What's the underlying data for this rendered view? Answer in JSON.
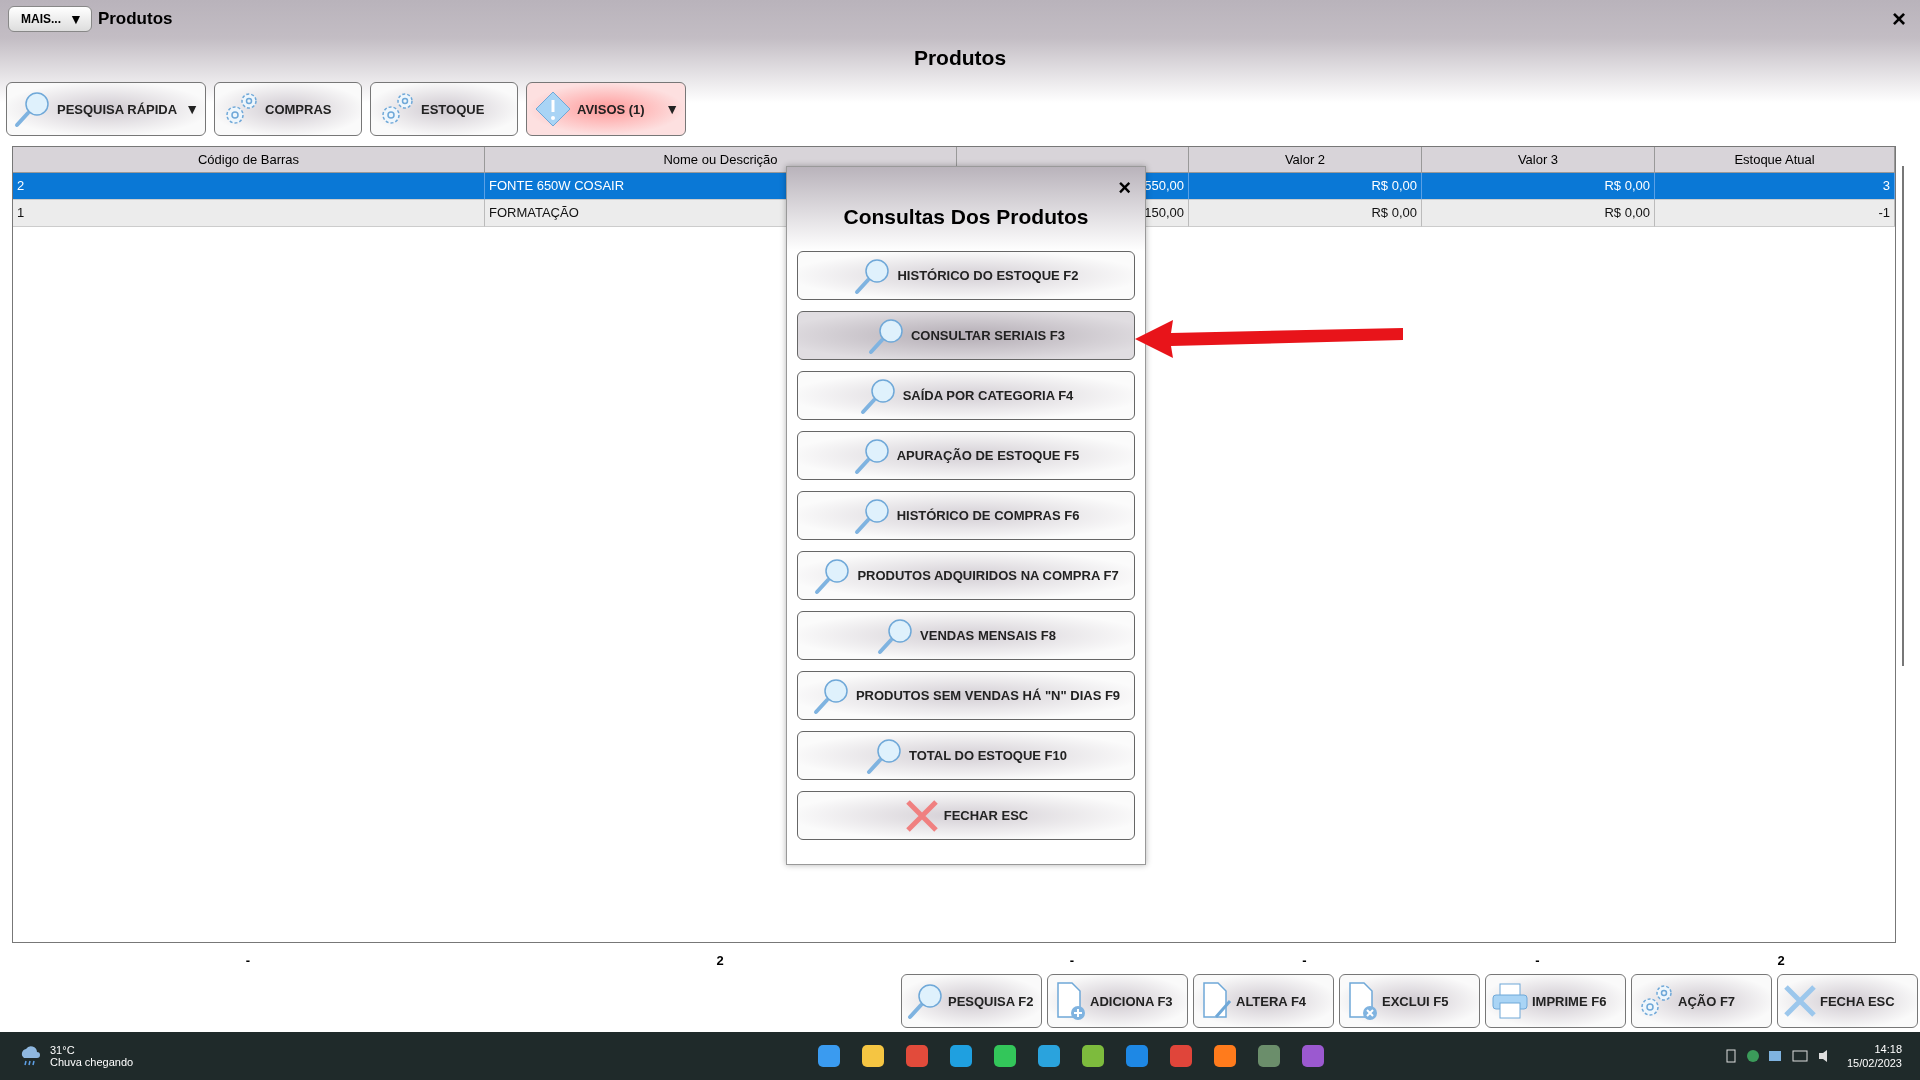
{
  "window": {
    "menu_button": "MAIS...",
    "menu_caret": "▼",
    "title": "Produtos",
    "close": "×"
  },
  "heading": "Produtos",
  "toolbar": [
    {
      "label": "PESQUISA RÁPIDA",
      "kind": "search",
      "caret": "▼",
      "alert": false
    },
    {
      "label": "COMPRAS",
      "kind": "gears",
      "alert": false
    },
    {
      "label": "ESTOQUE",
      "kind": "gears",
      "alert": false
    },
    {
      "label": "AVISOS (1)",
      "kind": "warning",
      "caret": "▼",
      "alert": true
    }
  ],
  "table": {
    "columns": [
      {
        "label": "Código de Barras"
      },
      {
        "label": "Nome ou Descrição"
      },
      {},
      {
        "label": "Valor 2"
      },
      {
        "label": "Valor 3"
      },
      {
        "label": "Estoque Atual"
      }
    ],
    "rows": [
      {
        "selected": true,
        "cells": [
          "2",
          "FONTE 650W COSAIR",
          "550,00",
          "R$ 0,00",
          "R$ 0,00",
          "3"
        ]
      },
      {
        "selected": false,
        "cells": [
          "1",
          "FORMATAÇÃO",
          "150,00",
          "R$ 0,00",
          "R$ 0,00",
          "-1"
        ]
      }
    ],
    "totals": [
      "-",
      "2",
      "-",
      "-",
      "-",
      "2"
    ]
  },
  "dialog": {
    "title": "Consultas Dos Produtos",
    "close": "×",
    "options": [
      {
        "label": "HISTÓRICO DO ESTOQUE F2",
        "kind": "search",
        "hovered": false
      },
      {
        "label": "CONSULTAR SERIAIS F3",
        "kind": "search",
        "hovered": true
      },
      {
        "label": "SAÍDA POR CATEGORIA F4",
        "kind": "search",
        "hovered": false
      },
      {
        "label": "APURAÇÃO DE ESTOQUE F5",
        "kind": "search",
        "hovered": false
      },
      {
        "label": "HISTÓRICO DE COMPRAS F6",
        "kind": "search",
        "hovered": false
      },
      {
        "label": "PRODUTOS ADQUIRIDOS NA COMPRA F7",
        "kind": "search",
        "hovered": false
      },
      {
        "label": "VENDAS MENSAIS F8",
        "kind": "search",
        "hovered": false
      },
      {
        "label": "PRODUTOS SEM VENDAS HÁ \"N\" DIAS F9",
        "kind": "search",
        "hovered": false
      },
      {
        "label": "TOTAL DO ESTOQUE F10",
        "kind": "search",
        "hovered": false
      },
      {
        "label": "FECHAR ESC",
        "kind": "close",
        "hovered": false
      }
    ]
  },
  "bottom_buttons": [
    {
      "label": "PESQUISA F2",
      "kind": "search"
    },
    {
      "label": "ADICIONA F3",
      "kind": "add"
    },
    {
      "label": "ALTERA F4",
      "kind": "edit"
    },
    {
      "label": "EXCLUI F5",
      "kind": "delete"
    },
    {
      "label": "IMPRIME F6",
      "kind": "print"
    },
    {
      "label": "AÇÃO F7",
      "kind": "gears"
    },
    {
      "label": "FECHA ESC",
      "kind": "close"
    }
  ],
  "taskbar": {
    "temperature": "31°C",
    "weather": "Chuva chegando",
    "time": "14:18",
    "date": "15/02/2023"
  }
}
